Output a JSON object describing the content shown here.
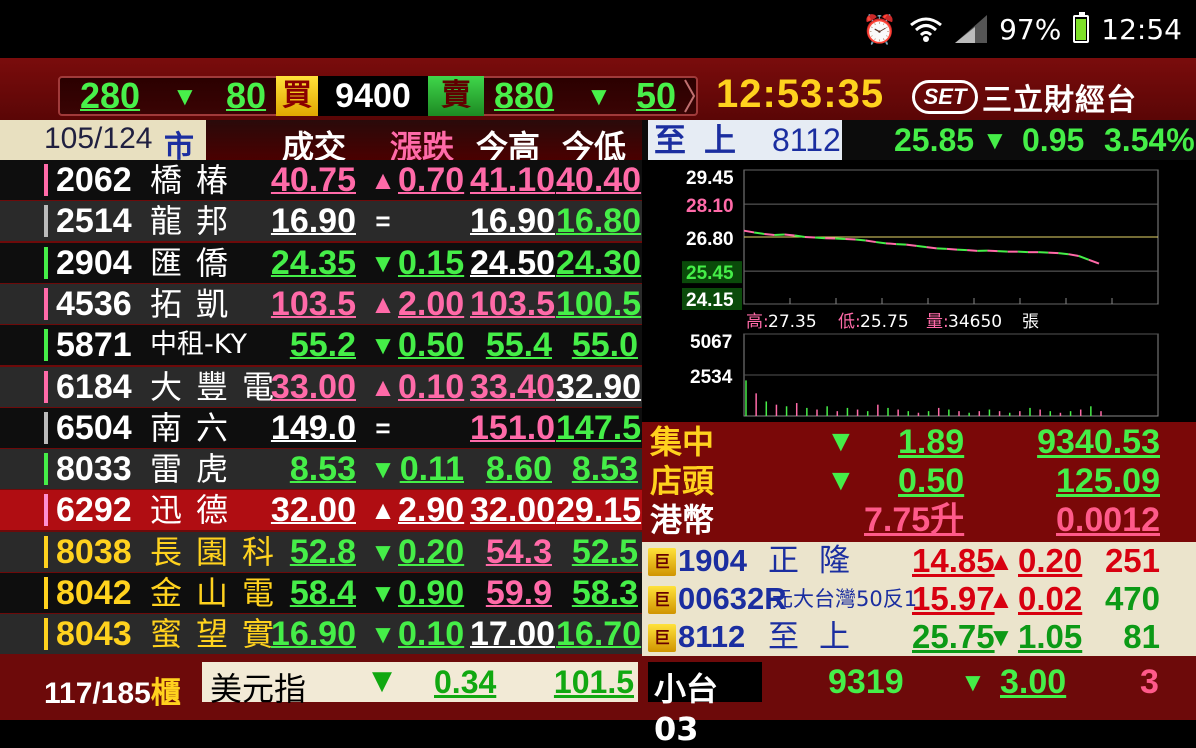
{
  "statusbar": {
    "battery_pct": "97%",
    "time": "12:54",
    "icons": [
      "alarm-clock-icon",
      "wifi-icon",
      "signal-icon",
      "battery-icon"
    ]
  },
  "ticker": {
    "left_vol": "280",
    "left_change": "80",
    "buy_label": "買",
    "price": "9400",
    "sell_label": "賣",
    "right_vol": "880",
    "right_change": "50",
    "clock": "12:53:35",
    "logo_badge": "SET",
    "logo_name": "三立財經台"
  },
  "table": {
    "date": "105/124",
    "market": "市",
    "headers": {
      "trade": "成交",
      "change": "漲跌",
      "high": "今高",
      "low": "今低"
    },
    "rows": [
      {
        "code": "2062",
        "name": "橋椿",
        "trade": "40.75",
        "dir": "▲",
        "change": "0.70",
        "high": "41.10",
        "low": "40.40",
        "ct": "red",
        "chc": "red",
        "hc": "red",
        "lc": "red",
        "bar": "#ff6aa8"
      },
      {
        "code": "2514",
        "name": "龍邦",
        "trade": "16.90",
        "dir": "=",
        "change": "",
        "high": "16.90",
        "low": "16.80",
        "ct": "wht",
        "chc": "wht",
        "hc": "wht",
        "lc": "grn",
        "bar": "#bbbbbb"
      },
      {
        "code": "2904",
        "name": "匯僑",
        "trade": "24.35",
        "dir": "▼",
        "change": "0.15",
        "high": "24.50",
        "low": "24.30",
        "ct": "grn",
        "chc": "grn",
        "hc": "wht",
        "lc": "grn",
        "bar": "#45ee48"
      },
      {
        "code": "4536",
        "name": "拓凱",
        "trade": "103.5",
        "dir": "▲",
        "change": "2.00",
        "high": "103.5",
        "low": "100.5",
        "ct": "red",
        "chc": "red",
        "hc": "red",
        "lc": "grn",
        "bar": "#ff6aa8"
      },
      {
        "code": "5871",
        "name": "中租-KY",
        "trade": "55.2",
        "dir": "▼",
        "change": "0.50",
        "high": "55.4",
        "low": "55.0",
        "ct": "grn",
        "chc": "grn",
        "hc": "grn",
        "lc": "grn",
        "bar": "#45ee48",
        "narrow": true
      },
      {
        "code": "6184",
        "name": "大豐電",
        "trade": "33.00",
        "dir": "▲",
        "change": "0.10",
        "high": "33.40",
        "low": "32.90",
        "ct": "red",
        "chc": "red",
        "hc": "red",
        "lc": "wht",
        "bar": "#ff6aa8"
      },
      {
        "code": "6504",
        "name": "南六",
        "trade": "149.0",
        "dir": "=",
        "change": "",
        "high": "151.0",
        "low": "147.5",
        "ct": "wht",
        "chc": "wht",
        "hc": "red",
        "lc": "grn",
        "bar": "#bbbbbb"
      },
      {
        "code": "8033",
        "name": "雷虎",
        "trade": "8.53",
        "dir": "▼",
        "change": "0.11",
        "high": "8.60",
        "low": "8.53",
        "ct": "grn",
        "chc": "grn",
        "hc": "grn",
        "lc": "grn",
        "bar": "#45ee48"
      },
      {
        "code": "6292",
        "name": "迅德",
        "trade": "32.00",
        "dir": "▲",
        "change": "2.90",
        "high": "32.00",
        "low": "29.15",
        "ct": "wht",
        "chc": "wht",
        "hc": "wht",
        "lc": "wht",
        "bar": "#ff8ed0",
        "hl": true
      },
      {
        "code": "8038",
        "name": "長園科",
        "trade": "52.8",
        "dir": "▼",
        "change": "0.20",
        "high": "54.3",
        "low": "52.5",
        "ct": "grn",
        "chc": "grn",
        "hc": "red",
        "lc": "grn",
        "bar": "#ffd21e",
        "yel": true
      },
      {
        "code": "8042",
        "name": "金山電",
        "trade": "58.4",
        "dir": "▼",
        "change": "0.90",
        "high": "59.9",
        "low": "58.3",
        "ct": "grn",
        "chc": "grn",
        "hc": "red",
        "lc": "grn",
        "bar": "#ffd21e",
        "yel": true
      },
      {
        "code": "8043",
        "name": "蜜望實",
        "trade": "16.90",
        "dir": "▼",
        "change": "0.10",
        "high": "17.00",
        "low": "16.70",
        "ct": "grn",
        "chc": "grn",
        "hc": "wht",
        "lc": "grn",
        "bar": "#ffd21e",
        "yel": true
      }
    ]
  },
  "bottom_left": {
    "count": "117/185",
    "market": "櫃",
    "index_name": "美元指",
    "dir": "▼",
    "change": "0.34",
    "value": "101.5"
  },
  "focus": {
    "name": "至上",
    "code": "8112",
    "price": "25.85",
    "dir": "▼",
    "change": "0.95",
    "pct": "3.54%"
  },
  "chart_data": {
    "type": "line",
    "price_ticks": [
      "29.45",
      "28.10",
      "26.80",
      "25.45",
      "24.15"
    ],
    "ylim": [
      24.15,
      29.45
    ],
    "reference": 26.8,
    "price_series": [
      27.05,
      26.98,
      26.92,
      26.88,
      26.9,
      26.86,
      26.8,
      26.78,
      26.75,
      26.74,
      26.72,
      26.7,
      26.66,
      26.6,
      26.55,
      26.52,
      26.5,
      26.45,
      26.4,
      26.35,
      26.33,
      26.3,
      26.28,
      26.25,
      26.26,
      26.24,
      26.22,
      26.22,
      26.2,
      26.2,
      26.18,
      26.16,
      26.12,
      26.05,
      25.9,
      25.75
    ],
    "stats": {
      "high_label": "高:",
      "high": "27.35",
      "low_label": "低:",
      "low": "25.75",
      "vol_label": "量:",
      "vol": "34650",
      "vol_unit": "張"
    },
    "vol_ticks": [
      "5067",
      "2534"
    ],
    "vol_ylim": [
      0,
      5067
    ],
    "vol_series": [
      2200,
      1400,
      900,
      700,
      600,
      800,
      500,
      400,
      600,
      300,
      500,
      400,
      300,
      700,
      500,
      400,
      300,
      200,
      300,
      500,
      400,
      300,
      200,
      300,
      400,
      300,
      200,
      300,
      500,
      400,
      300,
      200,
      300,
      400,
      600,
      300
    ]
  },
  "indices": [
    {
      "label": "集中",
      "dir": "▼",
      "change": "1.89",
      "value": "9340.53",
      "yel": true
    },
    {
      "label": "店頭",
      "dir": "▼",
      "change": "0.50",
      "value": "125.09",
      "yel": true
    },
    {
      "label": "港幣",
      "dir": "",
      "change": "7.75升",
      "value": "0.0012",
      "yel": false
    }
  ],
  "quotes": [
    {
      "icon": "巨",
      "code": "1904",
      "name": "正隆",
      "price": "14.85",
      "dir": "▲",
      "change": "0.20",
      "vol": "251",
      "pc": "qred",
      "vc": "qred"
    },
    {
      "icon": "巨",
      "code": "00632R",
      "name": "元大台灣50反1",
      "price": "15.97",
      "dir": "▲",
      "change": "0.02",
      "vol": "470",
      "pc": "qred",
      "vc": "qgrn",
      "narrow": true
    },
    {
      "icon": "巨",
      "code": "8112",
      "name": "至上",
      "price": "25.75",
      "dir": "▼",
      "change": "1.05",
      "vol": "81",
      "pc": "qgrn",
      "vc": "qgrn"
    }
  ],
  "bottom_right": {
    "name": "小台03",
    "price": "9319",
    "dir": "▼",
    "change": "3.00",
    "vol": "3"
  }
}
